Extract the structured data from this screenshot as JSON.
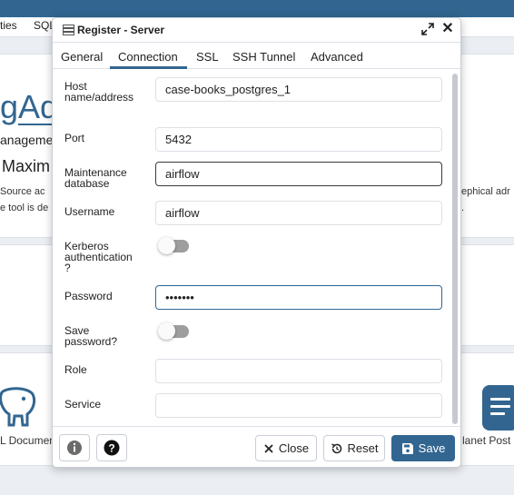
{
  "background": {
    "menu": [
      "ties",
      "SQL"
    ],
    "logo_text": "gAd",
    "line1": "anageme",
    "line2": "Maxim",
    "desc1": "Source ac",
    "desc2": "e tool is de",
    "desc_right1": "ephical adr",
    "desc_right2": ".",
    "link_left": "L Documen",
    "link_right": "lanet Post"
  },
  "dialog": {
    "title": "Register - Server",
    "tabs": [
      {
        "label": "General",
        "active": false
      },
      {
        "label": "Connection",
        "active": true
      },
      {
        "label": "SSL",
        "active": false
      },
      {
        "label": "SSH Tunnel",
        "active": false
      },
      {
        "label": "Advanced",
        "active": false
      }
    ],
    "fields": {
      "host": {
        "label": "Host name/address",
        "value": "case-books_postgres_1"
      },
      "port": {
        "label": "Port",
        "value": "5432"
      },
      "maintenance_db": {
        "label": "Maintenance database",
        "value": "airflow"
      },
      "username": {
        "label": "Username",
        "value": "airflow"
      },
      "kerberos": {
        "label": "Kerberos authentication?",
        "enabled": false
      },
      "password": {
        "label": "Password",
        "value": "•••••••"
      },
      "save_password": {
        "label": "Save password?",
        "enabled": false
      },
      "role": {
        "label": "Role",
        "value": ""
      },
      "service": {
        "label": "Service",
        "value": ""
      }
    },
    "footer": {
      "info_icon": "info-icon",
      "help_icon": "help-icon",
      "close_label": "Close",
      "reset_label": "Reset",
      "save_label": "Save"
    }
  },
  "colors": {
    "accent": "#326690",
    "toggle_off": "#9e9e9e",
    "border": "#dde0e6"
  }
}
